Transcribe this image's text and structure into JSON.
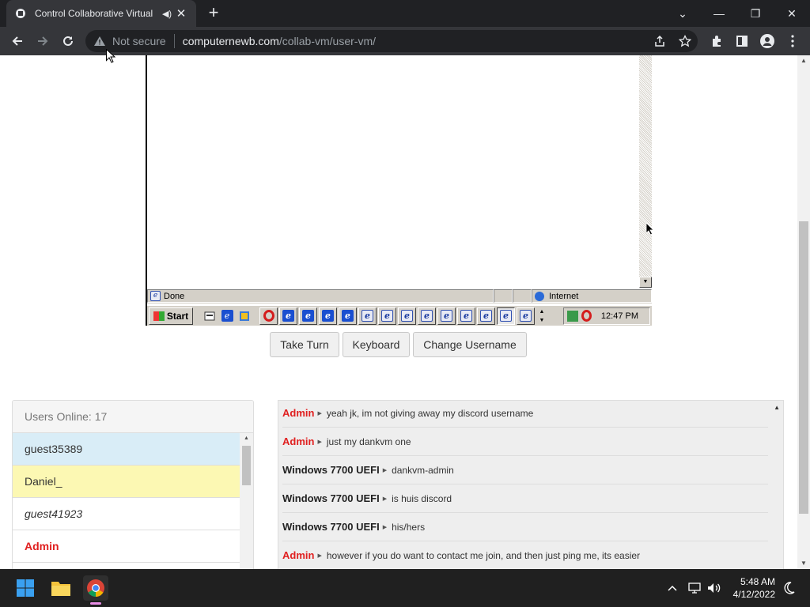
{
  "browser": {
    "tab_title": "Control Collaborative Virtual",
    "security_label": "Not secure",
    "url_host": "computernewb.com",
    "url_path": "/collab-vm/user-vm/"
  },
  "vm": {
    "status_text": "Done",
    "zone_text": "Internet",
    "start_label": "Start",
    "clock": "12:47 PM"
  },
  "controls": {
    "take_turn": "Take Turn",
    "keyboard": "Keyboard",
    "change_username": "Change Username"
  },
  "users": {
    "header": "Users Online: 17",
    "list": [
      {
        "name": "guest35389"
      },
      {
        "name": "Daniel_"
      },
      {
        "name": "guest41923"
      },
      {
        "name": "Admin"
      }
    ]
  },
  "chat": {
    "messages": [
      {
        "user": "Admin",
        "text": "yeah jk, im not giving away my discord username"
      },
      {
        "user": "Admin",
        "text": "just my dankvm one"
      },
      {
        "user": "Windows 7700 UEFI",
        "text": "dankvm-admin"
      },
      {
        "user": "Windows 7700 UEFI",
        "text": "is huis discord"
      },
      {
        "user": "Windows 7700 UEFI",
        "text": "his/hers"
      },
      {
        "user": "Admin",
        "text": "however if you do want to contact me join, and then just ping me, its easier"
      }
    ]
  },
  "taskbar": {
    "time": "5:48 AM",
    "date": "4/12/2022"
  },
  "colors": {
    "admin": "#e02020",
    "user_self_bg": "#d9edf7",
    "user_turn_bg": "#fcf8b3"
  }
}
